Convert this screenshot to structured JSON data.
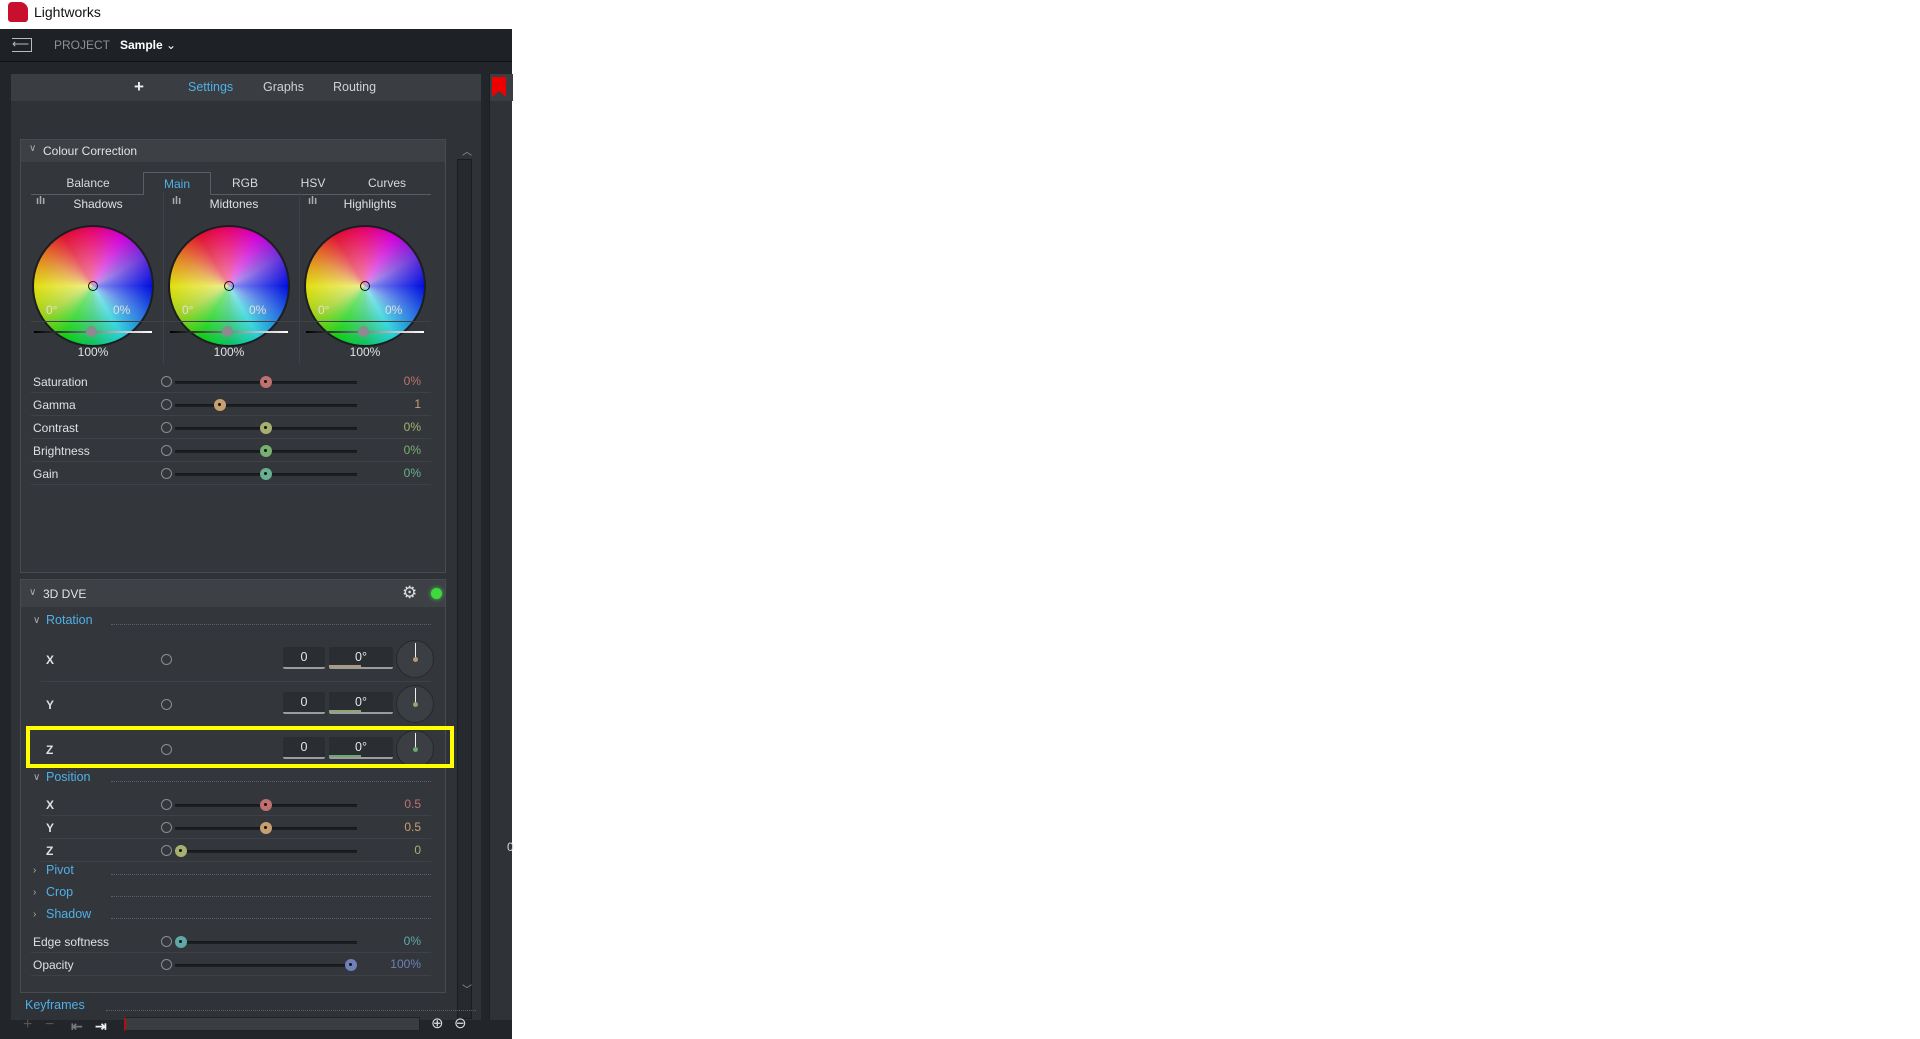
{
  "window": {
    "title": "Lightworks"
  },
  "header": {
    "project_label": "PROJECT",
    "project_name": "Sample",
    "chevron": "⌄"
  },
  "tabs": [
    {
      "label": "+"
    },
    {
      "label": "Settings",
      "active": true
    },
    {
      "label": "Graphs"
    },
    {
      "label": "Routing"
    }
  ],
  "colour_correction": {
    "title": "Colour Correction",
    "subtabs": [
      {
        "label": "Balance"
      },
      {
        "label": "Main",
        "active": true
      },
      {
        "label": "RGB"
      },
      {
        "label": "HSV"
      },
      {
        "label": "Curves"
      }
    ],
    "wheels": [
      {
        "label": "Shadows",
        "hue": "0°",
        "amount": "0%",
        "level": "100%"
      },
      {
        "label": "Midtones",
        "hue": "0°",
        "amount": "0%",
        "level": "100%"
      },
      {
        "label": "Highlights",
        "hue": "0°",
        "amount": "0%",
        "level": "100%"
      }
    ],
    "params": [
      {
        "label": "Saturation",
        "value": "0%",
        "pos": 0.5,
        "color": "#c07070"
      },
      {
        "label": "Gamma",
        "value": "1",
        "pos": 0.23,
        "color": "#c8a070"
      },
      {
        "label": "Contrast",
        "value": "0%",
        "pos": 0.5,
        "color": "#a8b070"
      },
      {
        "label": "Brightness",
        "value": "0%",
        "pos": 0.5,
        "color": "#78b070"
      },
      {
        "label": "Gain",
        "value": "0%",
        "pos": 0.5,
        "color": "#68b090"
      }
    ]
  },
  "dve": {
    "title": "3D DVE",
    "rotation": {
      "title": "Rotation",
      "rows": [
        {
          "axis": "X",
          "turns": "0",
          "angle": "0°",
          "color": "#b09a78"
        },
        {
          "axis": "Y",
          "turns": "0",
          "angle": "0°",
          "color": "#8aa870"
        },
        {
          "axis": "Z",
          "turns": "0",
          "angle": "0°",
          "color": "#6aa870"
        }
      ]
    },
    "position": {
      "title": "Position",
      "rows": [
        {
          "label": "X",
          "value": "0.5",
          "pos": 0.5,
          "color": "#c07070"
        },
        {
          "label": "Y",
          "value": "0.5",
          "pos": 0.5,
          "color": "#c8a070"
        },
        {
          "label": "Z",
          "value": "0",
          "pos": 0.0,
          "color": "#a8b070"
        }
      ]
    },
    "collapsed": [
      "Pivot",
      "Crop",
      "Shadow"
    ],
    "params": [
      {
        "label": "Edge softness",
        "value": "0%",
        "pos": 0.0,
        "color": "#60a8a8"
      },
      {
        "label": "Opacity",
        "value": "100%",
        "pos": 1.0,
        "color": "#7080b8"
      }
    ]
  },
  "keyframes": {
    "title": "Keyframes"
  },
  "highlight_color": "#ffff00",
  "accent": "#4fb0e8",
  "right_panel_value": "0"
}
